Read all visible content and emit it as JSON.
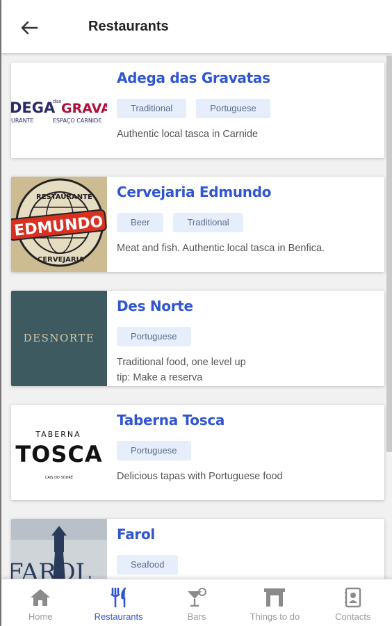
{
  "header": {
    "title": "Restaurants",
    "back_icon": "arrow-left-icon"
  },
  "restaurants": [
    {
      "name": "Adega das Gravatas",
      "tags": [
        "Traditional",
        "Portuguese"
      ],
      "description": "Authentic local tasca in Carnide",
      "logo": {
        "top": "DEGA",
        "mid": "das",
        "right": "GRAVATAS",
        "sub_left": "URANTE",
        "sub_right": "ESPAÇO CARNIDE"
      }
    },
    {
      "name": "Cervejaria Edmundo",
      "tags": [
        "Beer",
        "Traditional"
      ],
      "description": "Meat and fish. Authentic local tasca in Benfica.",
      "logo": {
        "ring_top": "RESTAURANTE",
        "banner": "EDMUNDO",
        "ring_bottom": "CERVEJARIA"
      }
    },
    {
      "name": "Des Norte",
      "tags": [
        "Portuguese"
      ],
      "description": "Traditional food, one level up",
      "description2": "tip: Make a reserva",
      "logo": {
        "text": "DESNORTE"
      }
    },
    {
      "name": "Taberna Tosca",
      "tags": [
        "Portuguese"
      ],
      "description": "Delicious tapas with Portuguese food",
      "logo": {
        "top": "TABERNA",
        "main": "TOSCA",
        "sub": "CAIS DO SODRÉ"
      }
    },
    {
      "name": "Farol",
      "tags": [
        "Seafood"
      ],
      "description": "",
      "logo": {
        "text": "FAROL"
      }
    }
  ],
  "nav": [
    {
      "label": "Home",
      "icon": "home-icon",
      "active": false
    },
    {
      "label": "Restaurants",
      "icon": "fork-knife-icon",
      "active": true
    },
    {
      "label": "Bars",
      "icon": "cocktail-icon",
      "active": false
    },
    {
      "label": "Things to do",
      "icon": "landmark-icon",
      "active": false
    },
    {
      "label": "Contacts",
      "icon": "contacts-icon",
      "active": false
    }
  ],
  "colors": {
    "accent": "#2f55d4",
    "tag_bg": "#e6eefb",
    "inactive": "#9a9a9a"
  }
}
